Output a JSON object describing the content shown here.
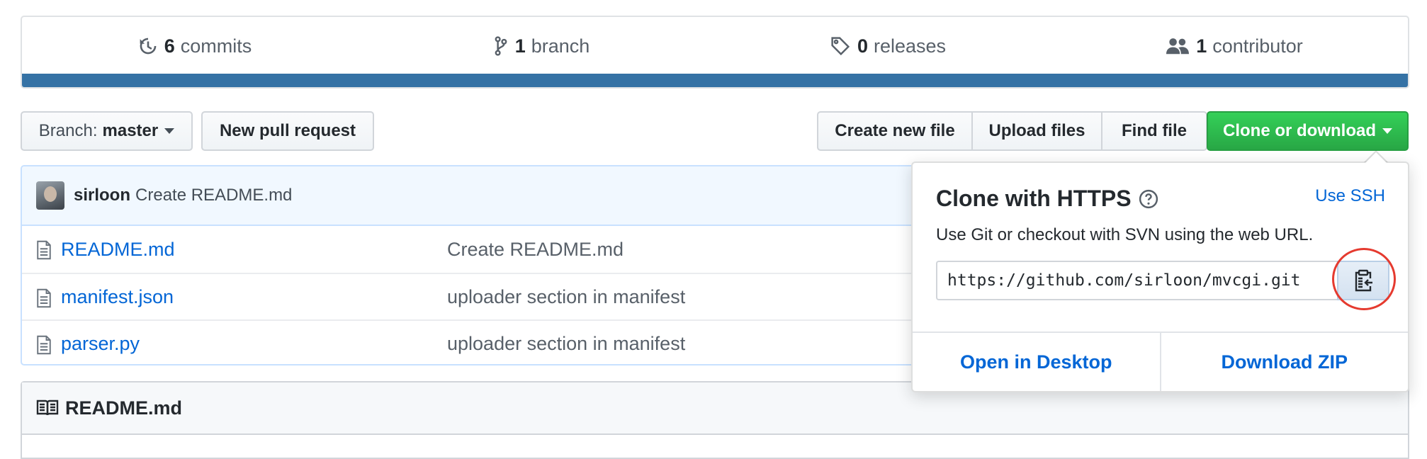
{
  "summary": {
    "commits": {
      "count": "6",
      "label": "commits",
      "icon": "history-icon"
    },
    "branches": {
      "count": "1",
      "label": "branch",
      "icon": "git-branch-icon"
    },
    "releases": {
      "count": "0",
      "label": "releases",
      "icon": "tag-icon"
    },
    "contributors": {
      "count": "1",
      "label": "contributor",
      "icon": "people-icon"
    },
    "language_color": "#3572a5"
  },
  "toolbar": {
    "branch_prefix": "Branch:",
    "branch_name": "master",
    "new_pull_request": "New pull request",
    "create_new_file": "Create new file",
    "upload_files": "Upload files",
    "find_file": "Find file",
    "clone_or_download": "Clone or download"
  },
  "commit": {
    "author": "sirloon",
    "message": "Create README.md"
  },
  "files": [
    {
      "name": "README.md",
      "message": "Create README.md"
    },
    {
      "name": "manifest.json",
      "message": "uploader section in manifest"
    },
    {
      "name": "parser.py",
      "message": "uploader section in manifest"
    }
  ],
  "readme": {
    "title": "README.md"
  },
  "clone_dropdown": {
    "title": "Clone with HTTPS",
    "use_ssh": "Use SSH",
    "description": "Use Git or checkout with SVN using the web URL.",
    "url": "https://github.com/sirloon/mvcgi.git",
    "open_in_desktop": "Open in Desktop",
    "download_zip": "Download ZIP"
  },
  "colors": {
    "link": "#0366d6",
    "primary_button": "#28a745",
    "highlight_ring": "#e53a2f"
  }
}
